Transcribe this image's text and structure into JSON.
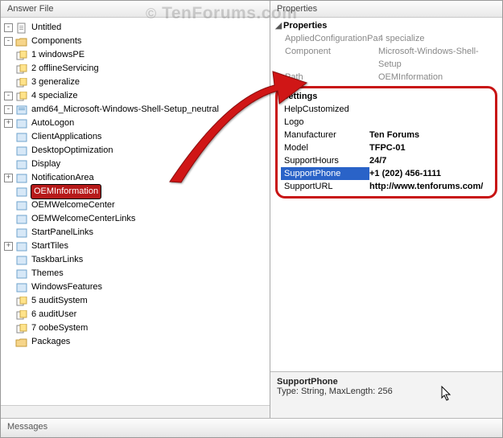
{
  "panes": {
    "left_header": "Answer File",
    "right_header": "Properties",
    "messages_header": "Messages"
  },
  "watermark": "TenForums.com",
  "tree": {
    "root": "Untitled",
    "components": "Components",
    "items": {
      "c1": "1 windowsPE",
      "c2": "2 offlineServicing",
      "c3": "3 generalize",
      "c4": "4 specialize",
      "c4_pkg": "amd64_Microsoft-Windows-Shell-Setup_neutral",
      "autologon": "AutoLogon",
      "clientapps": "ClientApplications",
      "desktopopt": "DesktopOptimization",
      "display": "Display",
      "notificationarea": "NotificationArea",
      "oeminfo": "OEMInformation",
      "oemwelcome": "OEMWelcomeCenter",
      "oemwelcomelinks": "OEMWelcomeCenterLinks",
      "startpanellinks": "StartPanelLinks",
      "starttiles": "StartTiles",
      "taskbarlinks": "TaskbarLinks",
      "themes": "Themes",
      "windowsfeatures": "WindowsFeatures",
      "c5": "5 auditSystem",
      "c6": "6 auditUser",
      "c7": "7 oobeSystem"
    },
    "packages": "Packages"
  },
  "properties": {
    "section_title": "Properties",
    "rows": {
      "appliedpass_k": "AppliedConfigurationPa:",
      "appliedpass_v": "4 specialize",
      "component_k": "Component",
      "component_v": "Microsoft-Windows-Shell-Setup",
      "path_k": "Path",
      "path_v": "OEMInformation"
    }
  },
  "settings": {
    "title": "Settings",
    "rows": {
      "helpcustomized_k": "HelpCustomized",
      "helpcustomized_v": "",
      "logo_k": "Logo",
      "logo_v": "",
      "manufacturer_k": "Manufacturer",
      "manufacturer_v": "Ten Forums",
      "model_k": "Model",
      "model_v": "TFPC-01",
      "supporthours_k": "SupportHours",
      "supporthours_v": "24/7",
      "supportphone_k": "SupportPhone",
      "supportphone_v": "+1 (202) 456-1111",
      "supporturl_k": "SupportURL",
      "supporturl_v": "http://www.tenforums.com/"
    }
  },
  "description": {
    "title": "SupportPhone",
    "text": "Type: String, MaxLength: 256"
  }
}
